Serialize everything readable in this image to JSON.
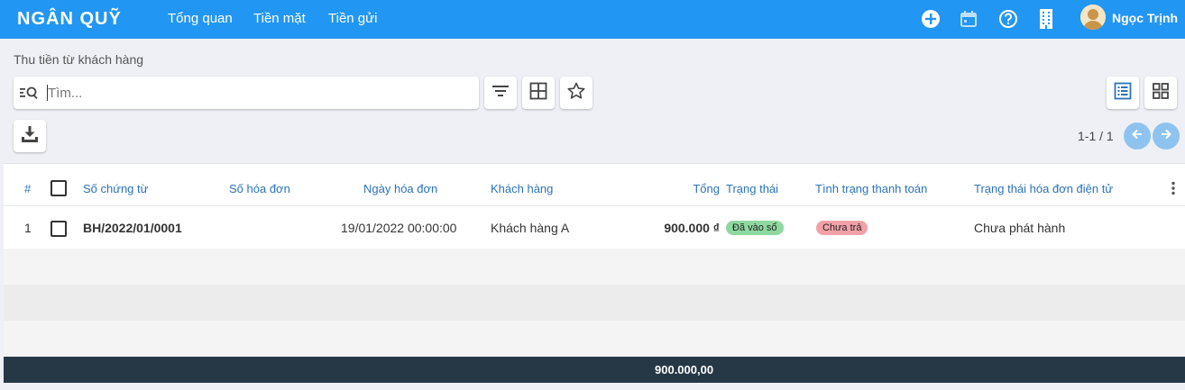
{
  "app": {
    "brand": "NGÂN QUỸ",
    "nav": [
      "Tổng quan",
      "Tiền mặt",
      "Tiền gửi"
    ],
    "user_name": "Ngọc Trịnh"
  },
  "page": {
    "breadcrumb": "Thu tiền từ khách hàng",
    "search_placeholder": "Tìm...",
    "pager": "1-1 / 1"
  },
  "table": {
    "headers": {
      "index": "#",
      "voucher_no": "Số chứng từ",
      "invoice_no": "Số hóa đơn",
      "invoice_date": "Ngày hóa đơn",
      "customer": "Khách hàng",
      "total": "Tổng",
      "status": "Trạng thái",
      "payment_status": "Tình trạng thanh toán",
      "einvoice_status": "Trạng thái hóa đơn điện tử"
    },
    "rows": [
      {
        "index": "1",
        "voucher_no": "BH/2022/01/0001",
        "invoice_no": "",
        "invoice_date": "19/01/2022 00:00:00",
        "customer": "Khách hàng A",
        "total": "900.000 ₫",
        "status": "Đã vào sổ",
        "payment_status": "Chưa trả",
        "einvoice_status": "Chưa phát hành"
      }
    ],
    "footer_total": "900.000,00"
  },
  "colors": {
    "topbar": "#2296f3",
    "header_text": "#2b73b8",
    "status_badge": "#8fd9a0",
    "payment_badge": "#f2a1a8",
    "footer": "#263746"
  }
}
